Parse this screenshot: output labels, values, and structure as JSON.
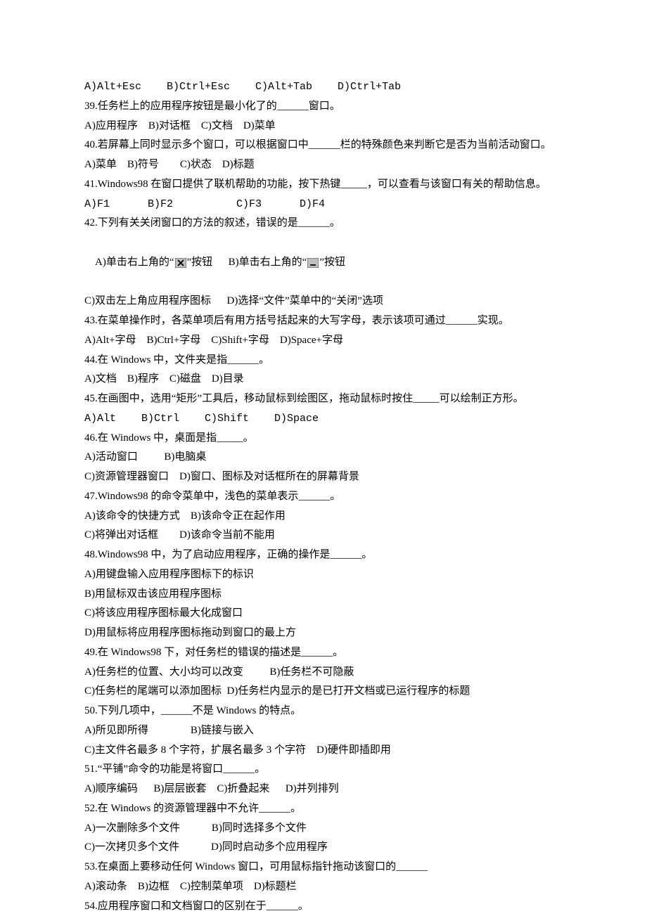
{
  "lines": {
    "opt38": "A)Alt+Esc    B)Ctrl+Esc    C)Alt+Tab    D)Ctrl+Tab",
    "q39": "39.任务栏上的应用程序按钮是最小化了的______窗口。",
    "opt39": "A)应用程序    B)对话框    C)文档    D)菜单",
    "q40": "40.若屏幕上同时显示多个窗口，可以根据窗口中______栏的特殊颜色来判断它是否为当前活动窗口。",
    "opt40": "A)菜单    B)符号        C)状态    D)标题",
    "q41": "41.Windows98 在窗口提供了联机帮助的功能，按下热键_____，可以查看与该窗口有关的帮助信息。",
    "opt41": "A)F1      B)F2          C)F3      D)F4",
    "q42": "42.下列有关关闭窗口的方法的叙述，错误的是______。",
    "q42a_pre": "A)单击右上角的“",
    "q42a_post": "”按钮      B)单击右上角的“",
    "q42a_end": "”按钮",
    "q42c": "C)双击左上角应用程序图标      D)选择“文件”菜单中的“关闭”选项",
    "q43": "43.在菜单操作时，各菜单项后有用方括号括起来的大写字母，表示该项可通过______实现。",
    "opt43": "A)Alt+字母    B)Ctrl+字母    C)Shift+字母    D)Space+字母",
    "q44": "44.在 Windows 中，文件夹是指______。",
    "opt44": "A)文档    B)程序    C)磁盘    D)目录",
    "q45": "45.在画图中，选用“矩形”工具后，移动鼠标到绘图区，拖动鼠标时按住_____可以绘制正方形。",
    "opt45": "A)Alt    B)Ctrl    C)Shift    D)Space",
    "q46": "46.在 Windows 中，桌面是指_____。",
    "opt46a": "A)活动窗口          B)电脑桌",
    "opt46c": "C)资源管理器窗口    D)窗口、图标及对话框所在的屏幕背景",
    "q47": "47.Windows98 的命令菜单中，浅色的菜单表示______。",
    "opt47a": "A)该命令的快捷方式    B)该命令正在起作用",
    "opt47c": "C)将弹出对话框        D)该命令当前不能用",
    "q48": "48.Windows98 中，为了启动应用程序，正确的操作是______。",
    "opt48a": "A)用键盘输入应用程序图标下的标识",
    "opt48b": "B)用鼠标双击该应用程序图标",
    "opt48c": "C)将该应用程序图标最大化成窗口",
    "opt48d": "D)用鼠标将应用程序图标拖动到窗口的最上方",
    "q49": "49.在 Windows98 下，对任务栏的错误的描述是______。",
    "opt49a": "A)任务栏的位置、大小均可以改变          B)任务栏不可隐蔽",
    "opt49c": "C)任务栏的尾端可以添加图标  D)任务栏内显示的是已打开文档或已运行程序的标题",
    "q50": "50.下列几项中，______不是 Windows 的特点。",
    "opt50a": "A)所见即所得                B)链接与嵌入",
    "opt50c": "C)主文件名最多 8 个字符，扩展名最多 3 个字符    D)硬件即插即用",
    "q51": "51.“平铺”命令的功能是将窗口______。",
    "opt51": "A)顺序编码      B)层层嵌套    C)折叠起来      D)并列排列",
    "q52": "52.在 Windows 的资源管理器中不允许______。",
    "opt52a": "A)一次删除多个文件            B)同时选择多个文件",
    "opt52c": "C)一次拷贝多个文件            D)同时启动多个应用程序",
    "q53": "53.在桌面上要移动任何 Windows 窗口，可用鼠标指针拖动该窗口的______",
    "opt53": "A)滚动条    B)边框    C)控制菜单项    D)标题栏",
    "q54": "54.应用程序窗口和文档窗口的区别在于______。"
  }
}
